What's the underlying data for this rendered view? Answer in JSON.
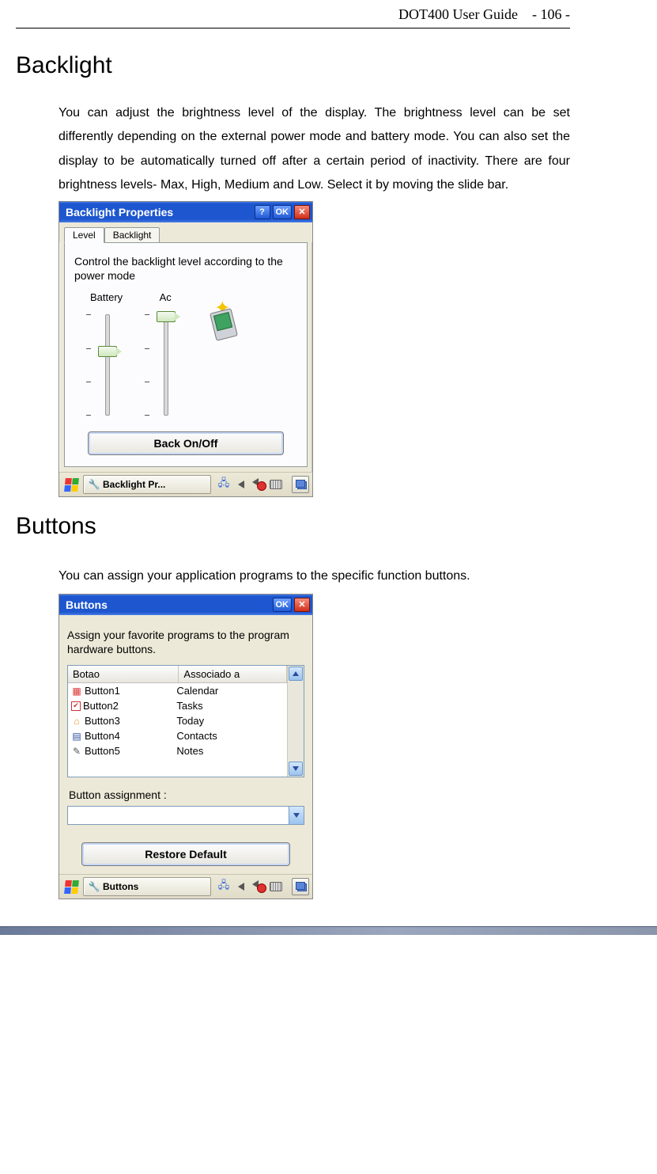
{
  "header": {
    "doc_title": "DOT400 User Guide",
    "page_no": "- 106 -"
  },
  "sections": {
    "backlight": {
      "heading": "Backlight",
      "para": "You can adjust the brightness level of the display. The brightness level can be set differently depending on the external power mode and battery mode. You can also set the display to be automatically turned off after a certain period of inactivity. There are four brightness levels- Max, High, Medium and Low. Select it by moving the slide bar."
    },
    "buttons": {
      "heading": "Buttons",
      "para": "You can assign your application programs to the specific function buttons."
    }
  },
  "backlight_window": {
    "title": "Backlight Properties",
    "help": "?",
    "ok": "OK",
    "tabs": {
      "level": "Level",
      "backlight": "Backlight"
    },
    "instruction": "Control the backlight level according to the power mode",
    "columns": {
      "battery": "Battery",
      "ac": "Ac"
    },
    "back_btn": "Back On/Off",
    "task_label": "Backlight Pr..."
  },
  "buttons_window": {
    "title": "Buttons",
    "ok": "OK",
    "instruction": "Assign your favorite programs to the program hardware buttons.",
    "headers": {
      "col1": "Botao",
      "col2": "Associado a"
    },
    "rows": [
      {
        "name": "Button1",
        "assoc": "Calendar"
      },
      {
        "name": "Button2",
        "assoc": "Tasks"
      },
      {
        "name": "Button3",
        "assoc": "Today"
      },
      {
        "name": "Button4",
        "assoc": "Contacts"
      },
      {
        "name": "Button5",
        "assoc": "Notes"
      }
    ],
    "assign_label": "Button assignment :",
    "restore_btn": "Restore Default",
    "task_label": "Buttons"
  }
}
